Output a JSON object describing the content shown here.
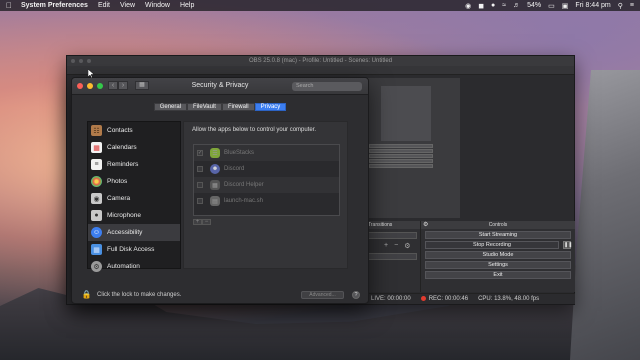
{
  "menubar": {
    "app": "System Preferences",
    "items": [
      "Edit",
      "View",
      "Window",
      "Help"
    ],
    "battery": "54%",
    "clock": "Fri 8:44 pm"
  },
  "obs": {
    "title": "OBS 25.0.8 (mac) - Profile: Untitled - Scenes: Untitled",
    "transitions_header": "Transitions",
    "controls_header": "Controls",
    "buttons": {
      "start_streaming": "Start Streaming",
      "stop_recording": "Stop Recording",
      "studio_mode": "Studio Mode",
      "settings": "Settings",
      "exit": "Exit"
    },
    "status": {
      "live": "LIVE: 00:00:00",
      "rec": "REC: 00:00:46",
      "cpu": "CPU: 13.8%, 48.00 fps"
    }
  },
  "security_privacy": {
    "title": "Security & Privacy",
    "search_placeholder": "Search",
    "tabs": [
      {
        "label": "General",
        "selected": false
      },
      {
        "label": "FileVault",
        "selected": false
      },
      {
        "label": "Firewall",
        "selected": false
      },
      {
        "label": "Privacy",
        "selected": true
      }
    ],
    "sidebar": [
      {
        "label": "Contacts",
        "icon": "contacts-icon",
        "color": "#b07a4a",
        "selected": false
      },
      {
        "label": "Calendars",
        "icon": "calendar-icon",
        "color": "#f2f2f2",
        "selected": false
      },
      {
        "label": "Reminders",
        "icon": "reminders-icon",
        "color": "#f2f2f2",
        "selected": false
      },
      {
        "label": "Photos",
        "icon": "photos-icon",
        "color": "#e8a23a",
        "selected": false
      },
      {
        "label": "Camera",
        "icon": "camera-icon",
        "color": "#c9c9c9",
        "selected": false
      },
      {
        "label": "Microphone",
        "icon": "microphone-icon",
        "color": "#c9c9c9",
        "selected": false
      },
      {
        "label": "Accessibility",
        "icon": "accessibility-icon",
        "color": "#3c7ef0",
        "selected": true
      },
      {
        "label": "Full Disk Access",
        "icon": "folder-icon",
        "color": "#4a90e2",
        "selected": false
      },
      {
        "label": "Automation",
        "icon": "gear-icon",
        "color": "#9a9a9a",
        "selected": false
      }
    ],
    "panel_description": "Allow the apps below to control your computer.",
    "apps": [
      {
        "name": "BlueStacks",
        "checked": true
      },
      {
        "name": "Discord",
        "checked": false
      },
      {
        "name": "Discord Helper",
        "checked": false
      },
      {
        "name": "launch-mac.sh",
        "checked": false
      }
    ],
    "lock_text": "Click the lock to make changes.",
    "advanced_label": "Advanced...",
    "help_label": "?"
  }
}
